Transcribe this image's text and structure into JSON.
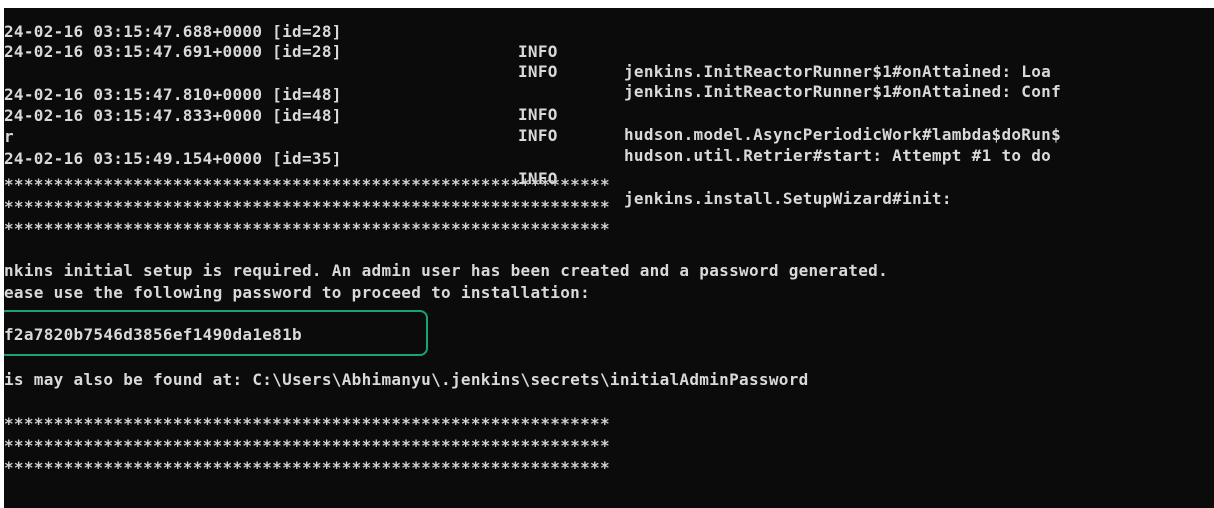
{
  "log_lines": [
    {
      "time": "24-02-16 03:15:47.688+0000 [id=28]",
      "level": "INFO",
      "message": "jenkins.InitReactorRunner$1#onAttained: Loa"
    },
    {
      "time": "24-02-16 03:15:47.691+0000 [id=28]",
      "level": "INFO",
      "message": "jenkins.InitReactorRunner$1#onAttained: Conf"
    },
    {
      "time": "24-02-16 03:15:47.810+0000 [id=48]",
      "level": "INFO",
      "message": "hudson.model.AsyncPeriodicWork#lambda$doRun$"
    },
    {
      "time": "24-02-16 03:15:47.833+0000 [id=48]",
      "level": "INFO",
      "message": "hudson.util.Retrier#start: Attempt #1 to do"
    },
    {
      "time": "r",
      "level": "",
      "message": ""
    },
    {
      "time": "24-02-16 03:15:49.154+0000 [id=35]",
      "level": "INFO",
      "message": "jenkins.install.SetupWizard#init:"
    }
  ],
  "stars_line": "*************************************************************",
  "setup_message_1": "nkins initial setup is required. An admin user has been created and a password generated.",
  "setup_message_2": "ease use the following password to proceed to installation:",
  "password": "f2a7820b7546d3856ef1490da1e81b",
  "found_at": "is may also be found at: C:\\Users\\Abhimanyu\\.jenkins\\secrets\\initialAdminPassword",
  "colors": {
    "background": "#0b0b0b",
    "text": "#d9d9d9",
    "highlight": "#1aa377"
  }
}
